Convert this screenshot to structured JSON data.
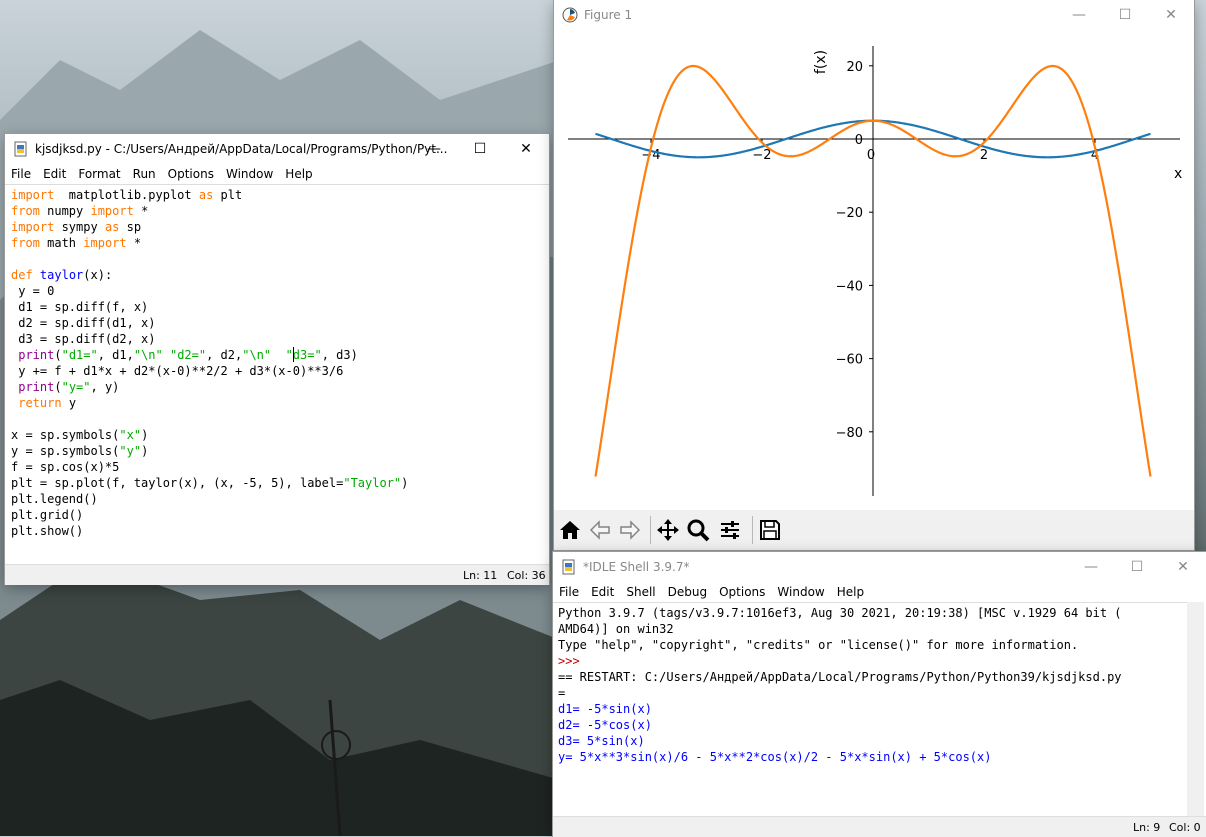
{
  "editor": {
    "title": "kjsdjksd.py - C:/Users/Андрей/AppData/Local/Programs/Python/Pyt...",
    "menu": [
      "File",
      "Edit",
      "Format",
      "Run",
      "Options",
      "Window",
      "Help"
    ],
    "status_line": "Ln: 11",
    "status_col": "Col: 36",
    "code": [
      [
        [
          "kw",
          "import"
        ],
        [
          "",
          "  matplotlib.pyplot "
        ],
        [
          "kw",
          "as"
        ],
        [
          "",
          " plt"
        ]
      ],
      [
        [
          "kw",
          "from"
        ],
        [
          "",
          " numpy "
        ],
        [
          "kw",
          "import"
        ],
        [
          "",
          " *"
        ]
      ],
      [
        [
          "kw",
          "import"
        ],
        [
          "",
          " sympy "
        ],
        [
          "kw",
          "as"
        ],
        [
          "",
          " sp"
        ]
      ],
      [
        [
          "kw",
          "from"
        ],
        [
          "",
          " math "
        ],
        [
          "kw",
          "import"
        ],
        [
          "",
          " *"
        ]
      ],
      [],
      [
        [
          "kw",
          "def"
        ],
        [
          "",
          " "
        ],
        [
          "def",
          "taylor"
        ],
        [
          "",
          "(x):"
        ]
      ],
      [
        [
          "",
          " y = 0"
        ]
      ],
      [
        [
          "",
          " d1 = sp.diff(f, x)"
        ]
      ],
      [
        [
          "",
          " d2 = sp.diff(d1, x)"
        ]
      ],
      [
        [
          "",
          " d3 = sp.diff(d2, x)"
        ]
      ],
      [
        [
          "",
          " "
        ],
        [
          "bi",
          "print"
        ],
        [
          "",
          "("
        ],
        [
          "str",
          "\"d1=\""
        ],
        [
          "",
          ", d1,"
        ],
        [
          "str",
          "\"\\n\" \"d2=\""
        ],
        [
          "",
          ", d2,"
        ],
        [
          "str",
          "\"\\n\"  \"d3=\""
        ],
        [
          "",
          ", d3)"
        ]
      ],
      [
        [
          "",
          " y += f + d1*x + d2*(x-0)**2/2 + d3*(x-0)**3/6"
        ]
      ],
      [
        [
          "",
          " "
        ],
        [
          "bi",
          "print"
        ],
        [
          "",
          "("
        ],
        [
          "str",
          "\"y=\""
        ],
        [
          "",
          ", y)"
        ]
      ],
      [
        [
          "",
          " "
        ],
        [
          "kw",
          "return"
        ],
        [
          "",
          " y"
        ]
      ],
      [],
      [
        [
          "",
          "x = sp.symbols("
        ],
        [
          "str",
          "\"x\""
        ],
        [
          "",
          ")"
        ]
      ],
      [
        [
          "",
          "y = sp.symbols("
        ],
        [
          "str",
          "\"y\""
        ],
        [
          "",
          ")"
        ]
      ],
      [
        [
          "",
          "f = sp.cos(x)*5"
        ]
      ],
      [
        [
          "",
          "plt = sp.plot(f, taylor(x), (x, -5, 5), label="
        ],
        [
          "str",
          "\"Taylor\""
        ],
        [
          "",
          ")"
        ]
      ],
      [
        [
          "",
          "plt.legend()"
        ]
      ],
      [
        [
          "",
          "plt.grid()"
        ]
      ],
      [
        [
          "",
          "plt.show()"
        ]
      ]
    ]
  },
  "figure": {
    "title": "Figure 1",
    "toolbar": [
      "home-icon",
      "back-icon",
      "forward-icon",
      "pan-icon",
      "zoom-icon",
      "configure-subplots-icon",
      "save-icon"
    ]
  },
  "chart_data": {
    "type": "line",
    "title": "",
    "xlabel": "x",
    "ylabel": "f(x)",
    "xlim": [
      -5,
      5
    ],
    "ylim": [
      -98,
      25
    ],
    "x_ticks": [
      -4,
      -2,
      0,
      2,
      4
    ],
    "x_tick_labels": [
      "−4",
      "−2",
      "0",
      "2",
      "4"
    ],
    "y_ticks": [
      -80,
      -60,
      -40,
      -20,
      0,
      20
    ],
    "y_tick_labels": [
      "−80",
      "−60",
      "−40",
      "−20",
      "0",
      "20"
    ],
    "grid": false,
    "series": [
      {
        "expr": "5*cos(x)",
        "color": "#1f77b4"
      },
      {
        "expr": "5*x**3*sin(x)/6 - 5*x**2*cos(x)/2 - 5*x*sin(x) + 5*cos(x)",
        "color": "#ff7f0e"
      }
    ]
  },
  "shell": {
    "title": "*IDLE Shell 3.9.7*",
    "menu": [
      "File",
      "Edit",
      "Shell",
      "Debug",
      "Options",
      "Window",
      "Help"
    ],
    "status_line": "Ln: 9",
    "status_col": "Col: 0",
    "lines": [
      {
        "c": "",
        "t": "Python 3.9.7 (tags/v3.9.7:1016ef3, Aug 30 2021, 20:19:38) [MSC v.1929 64 bit ("
      },
      {
        "c": "",
        "t": "AMD64)] on win32"
      },
      {
        "c": "",
        "t": "Type \"help\", \"copyright\", \"credits\" or \"license()\" for more information."
      },
      {
        "c": "err",
        "t": ">>> "
      },
      {
        "c": "",
        "t": "== RESTART: C:/Users/Андрей/AppData/Local/Programs/Python/Python39/kjsdjksd.py"
      },
      {
        "c": "",
        "t": "="
      },
      {
        "c": "out",
        "t": "d1= -5*sin(x)"
      },
      {
        "c": "out",
        "t": "d2= -5*cos(x)"
      },
      {
        "c": "out",
        "t": "d3= 5*sin(x)"
      },
      {
        "c": "out",
        "t": "y= 5*x**3*sin(x)/6 - 5*x**2*cos(x)/2 - 5*x*sin(x) + 5*cos(x)"
      }
    ]
  }
}
